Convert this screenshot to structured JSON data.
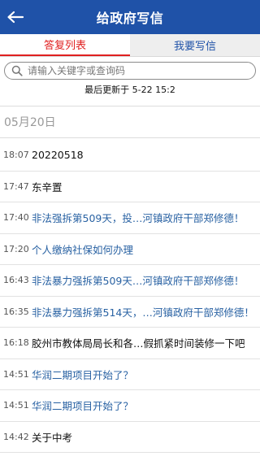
{
  "header": {
    "title": "给政府写信",
    "back_icon": "left-arrow-icon"
  },
  "tabs": [
    {
      "label": "答复列表",
      "active": true
    },
    {
      "label": "我要写信",
      "active": false
    }
  ],
  "search": {
    "placeholder": "请输入关键字或查询码",
    "value": ""
  },
  "updated_text": "最后更新于 5-22 15:2",
  "date_header": "05月20日",
  "items": [
    {
      "time": "18:07",
      "title": "20220518",
      "style": "dark"
    },
    {
      "time": "17:47",
      "title": "东辛置",
      "style": "dark"
    },
    {
      "time": "17:40",
      "title": "非法强拆第509天，投…河镇政府干部郑修德！",
      "style": "blue"
    },
    {
      "time": "17:20",
      "title": "个人缴纳社保如何办理",
      "style": "blue"
    },
    {
      "time": "16:43",
      "title": "非法暴力强拆第509天…河镇政府干部郑修德！",
      "style": "blue"
    },
    {
      "time": "16:35",
      "title": "非法暴力强拆第514天，…河镇政府干部郑修德！",
      "style": "blue"
    },
    {
      "time": "16:18",
      "title": "胶州市教体局局长和各…假抓紧时间装修一下吧",
      "style": "dark"
    },
    {
      "time": "14:51",
      "title": "华润二期项目开始了？",
      "style": "blue"
    },
    {
      "time": "14:51",
      "title": "华润二期项目开始了？",
      "style": "blue"
    },
    {
      "time": "14:42",
      "title": "关于中考",
      "style": "dark"
    }
  ],
  "colors": {
    "header_bg": "#1f52a8",
    "active_tab": "#e02020",
    "link": "#2962a3"
  }
}
